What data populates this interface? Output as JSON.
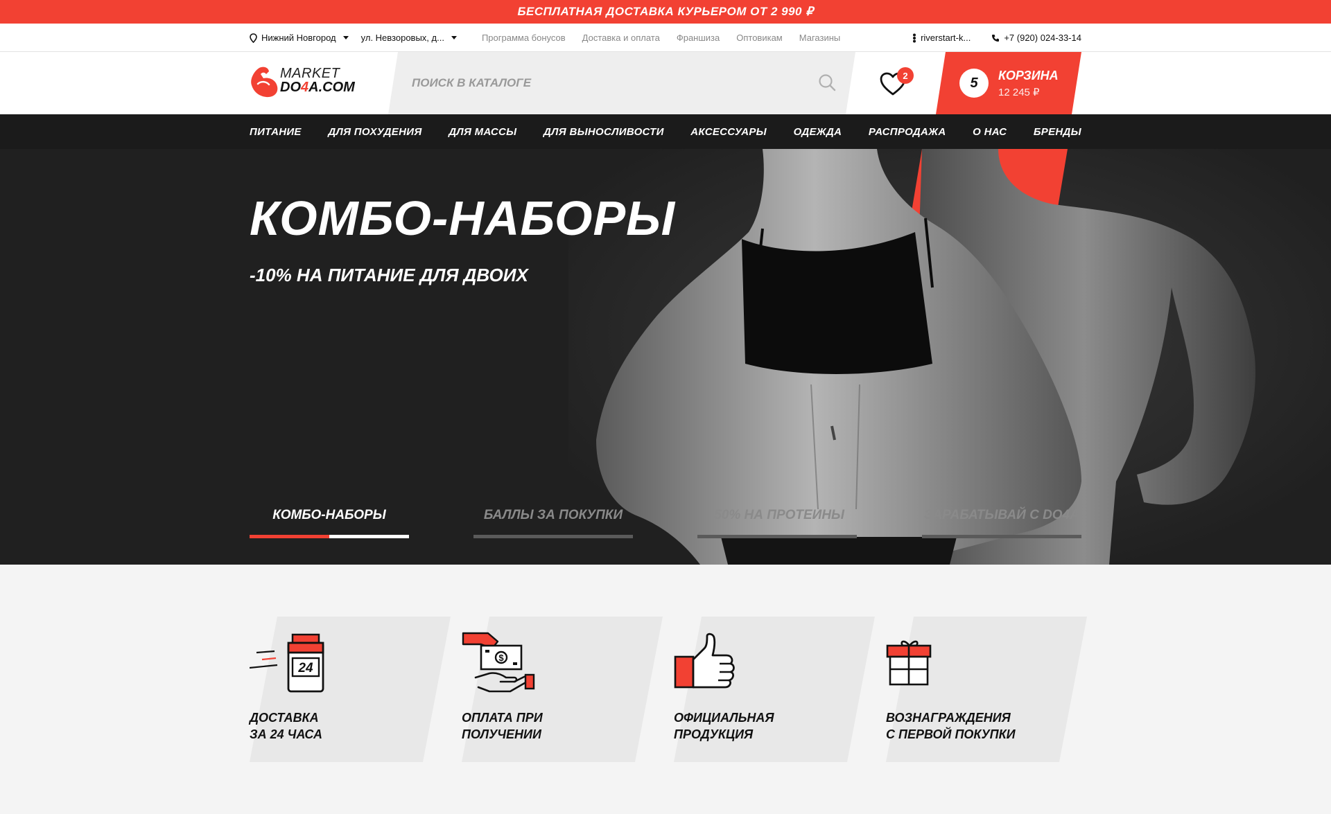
{
  "promo": {
    "text": "БЕСПЛАТНАЯ ДОСТАВКА КУРЬЕРОМ ОТ 2 990 ₽"
  },
  "topbar": {
    "city": "Нижний Новгород",
    "address": "ул. Невзоровых, д...",
    "links": [
      "Программа бонусов",
      "Доставка и оплата",
      "Франшиза",
      "Оптовикам",
      "Магазины"
    ],
    "account": "riverstart-k...",
    "phone": "+7 (920) 024-33-14"
  },
  "header": {
    "logo_line1": "MARKET",
    "logo_line2_a": "DO",
    "logo_line2_b": "4",
    "logo_line2_c": "A.COM",
    "search_placeholder": "ПОИСК В КАТАЛОГЕ",
    "favorites_count": "2",
    "cart": {
      "count": "5",
      "title": "КОРЗИНА",
      "sum": "12 245 ₽"
    }
  },
  "nav": [
    "ПИТАНИЕ",
    "ДЛЯ ПОХУДЕНИЯ",
    "ДЛЯ МАССЫ",
    "ДЛЯ ВЫНОСЛИВОСТИ",
    "АКСЕССУАРЫ",
    "ОДЕЖДА",
    "РАСПРОДАЖА",
    "О НАС",
    "БРЕНДЫ"
  ],
  "hero": {
    "title": "КОМБО-НАБОРЫ",
    "subtitle": "-10% НА ПИТАНИЕ ДЛЯ ДВОИХ",
    "tabs": [
      {
        "label": "КОМБО-НАБОРЫ",
        "active": true,
        "progress": 0.5
      },
      {
        "label": "БАЛЛЫ ЗА ПОКУПКИ",
        "active": false,
        "progress": 0
      },
      {
        "label": "-50% НА ПРОТЕИНЫ",
        "active": false,
        "progress": 0
      },
      {
        "label": "ЗАРАБАТЫВАЙ С DO4A",
        "active": false,
        "progress": 0
      }
    ]
  },
  "features": [
    {
      "icon": "delivery-jar-icon",
      "line1": "ДОСТАВКА",
      "line2": "ЗА 24 ЧАСА",
      "jar_label": "24"
    },
    {
      "icon": "cash-payment-icon",
      "line1": "ОПЛАТА ПРИ",
      "line2": "ПОЛУЧЕНИИ"
    },
    {
      "icon": "thumbs-up-icon",
      "line1": "ОФИЦИАЛЬНАЯ",
      "line2": "ПРОДУКЦИЯ"
    },
    {
      "icon": "gift-icon",
      "line1": "ВОЗНАГРАЖДЕНИЯ",
      "line2": "С ПЕРВОЙ ПОКУПКИ"
    }
  ],
  "colors": {
    "accent": "#f24133",
    "dark": "#1b1b1b",
    "hero_bg": "#202020",
    "page_bg": "#f4f4f4"
  }
}
